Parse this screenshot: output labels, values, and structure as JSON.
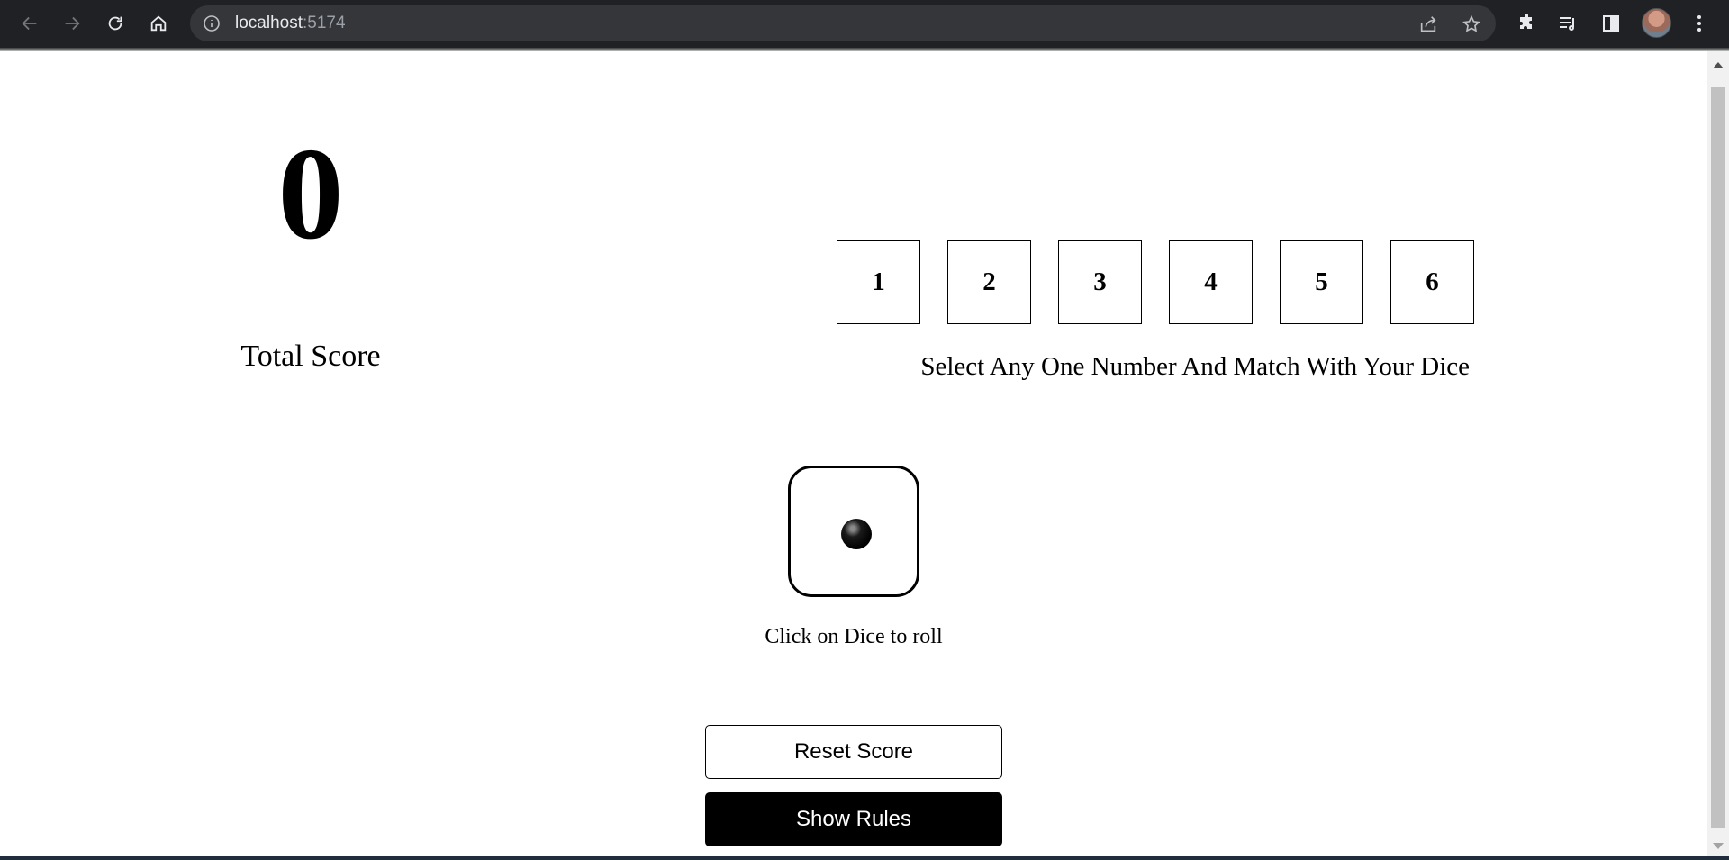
{
  "browser": {
    "url_host": "localhost",
    "url_port": ":5174",
    "icons": {
      "back": "arrow-left-icon",
      "forward": "arrow-right-icon",
      "reload": "reload-icon",
      "home": "home-icon",
      "site_info": "info-icon",
      "share": "share-icon",
      "bookmark": "star-icon",
      "extensions": "puzzle-icon",
      "reading_list": "reading-list-icon",
      "side_panel": "side-panel-icon",
      "menu": "kebab-menu-icon"
    }
  },
  "score": {
    "value": "0",
    "label": "Total Score"
  },
  "number_selector": {
    "numbers": [
      "1",
      "2",
      "3",
      "4",
      "5",
      "6"
    ],
    "hint": "Select Any One Number And Match With Your Dice"
  },
  "dice": {
    "face_value": 1,
    "hint": "Click on Dice to roll"
  },
  "actions": {
    "reset_label": "Reset Score",
    "rules_label": "Show Rules"
  },
  "colors": {
    "chrome_bg": "#202124",
    "omnibox_bg": "#35363a",
    "page_bg": "#ffffff",
    "primary_button_bg": "#000000"
  }
}
